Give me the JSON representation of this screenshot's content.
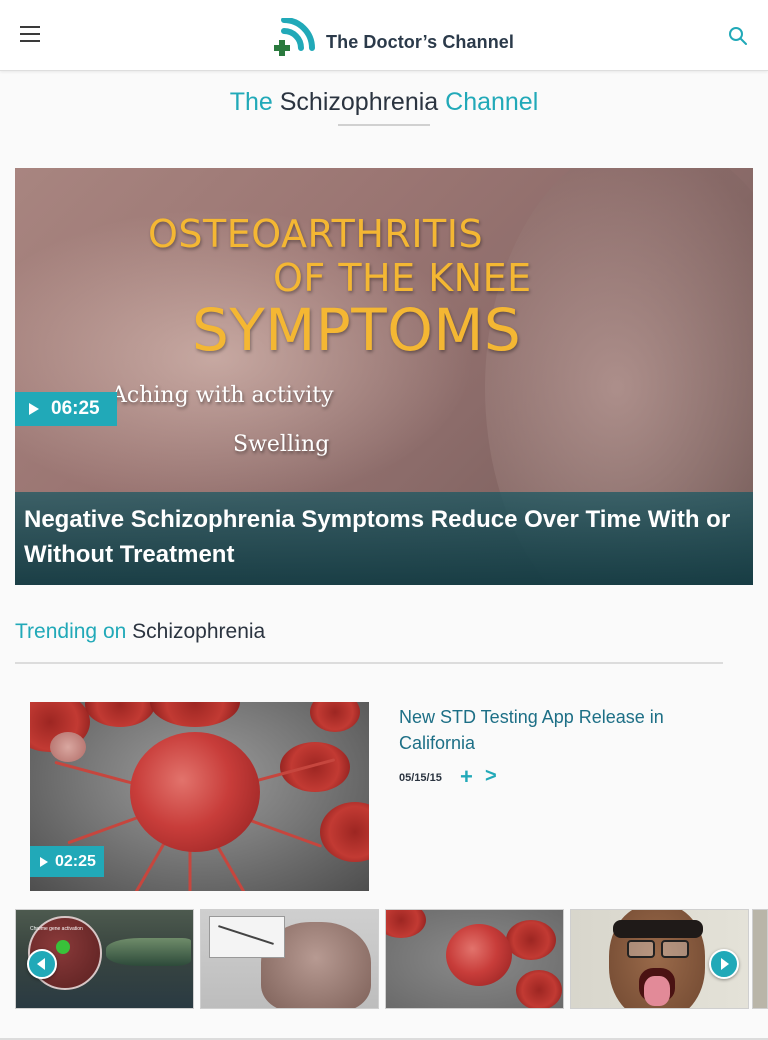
{
  "header": {
    "logo_text": "The Doctor’s Channel",
    "menu_icon": "hamburger-menu-icon",
    "search_icon": "search-icon",
    "brand_color": "#21a9b8"
  },
  "channel": {
    "title_prefix": "The",
    "title_topic": "Schizophrenia",
    "title_suffix": "Channel"
  },
  "hero": {
    "image_text": {
      "line1": "OSTEOARTHRITIS",
      "line2": "OF THE KNEE",
      "line3": "SYMPTOMS",
      "sub1": "Aching with activity",
      "sub2": "Swelling"
    },
    "duration": "06:25",
    "caption": "Negative Schizophrenia Symptoms Reduce Over Time With or Without Treatment"
  },
  "trending": {
    "label_prefix": "Trending on",
    "label_topic": "Schizophrenia",
    "featured": {
      "duration": "02:25",
      "title": "New STD Testing App Release in California",
      "date": "05/15/15",
      "add_icon": "plus-icon",
      "share_icon": "share-icon"
    },
    "thumbnails": [
      {
        "name": "thumb-1",
        "caption": "Chrome gene activation"
      },
      {
        "name": "thumb-2"
      },
      {
        "name": "thumb-3"
      },
      {
        "name": "thumb-4"
      }
    ],
    "prev_icon": "chevron-left-icon",
    "next_icon": "chevron-right-icon"
  }
}
